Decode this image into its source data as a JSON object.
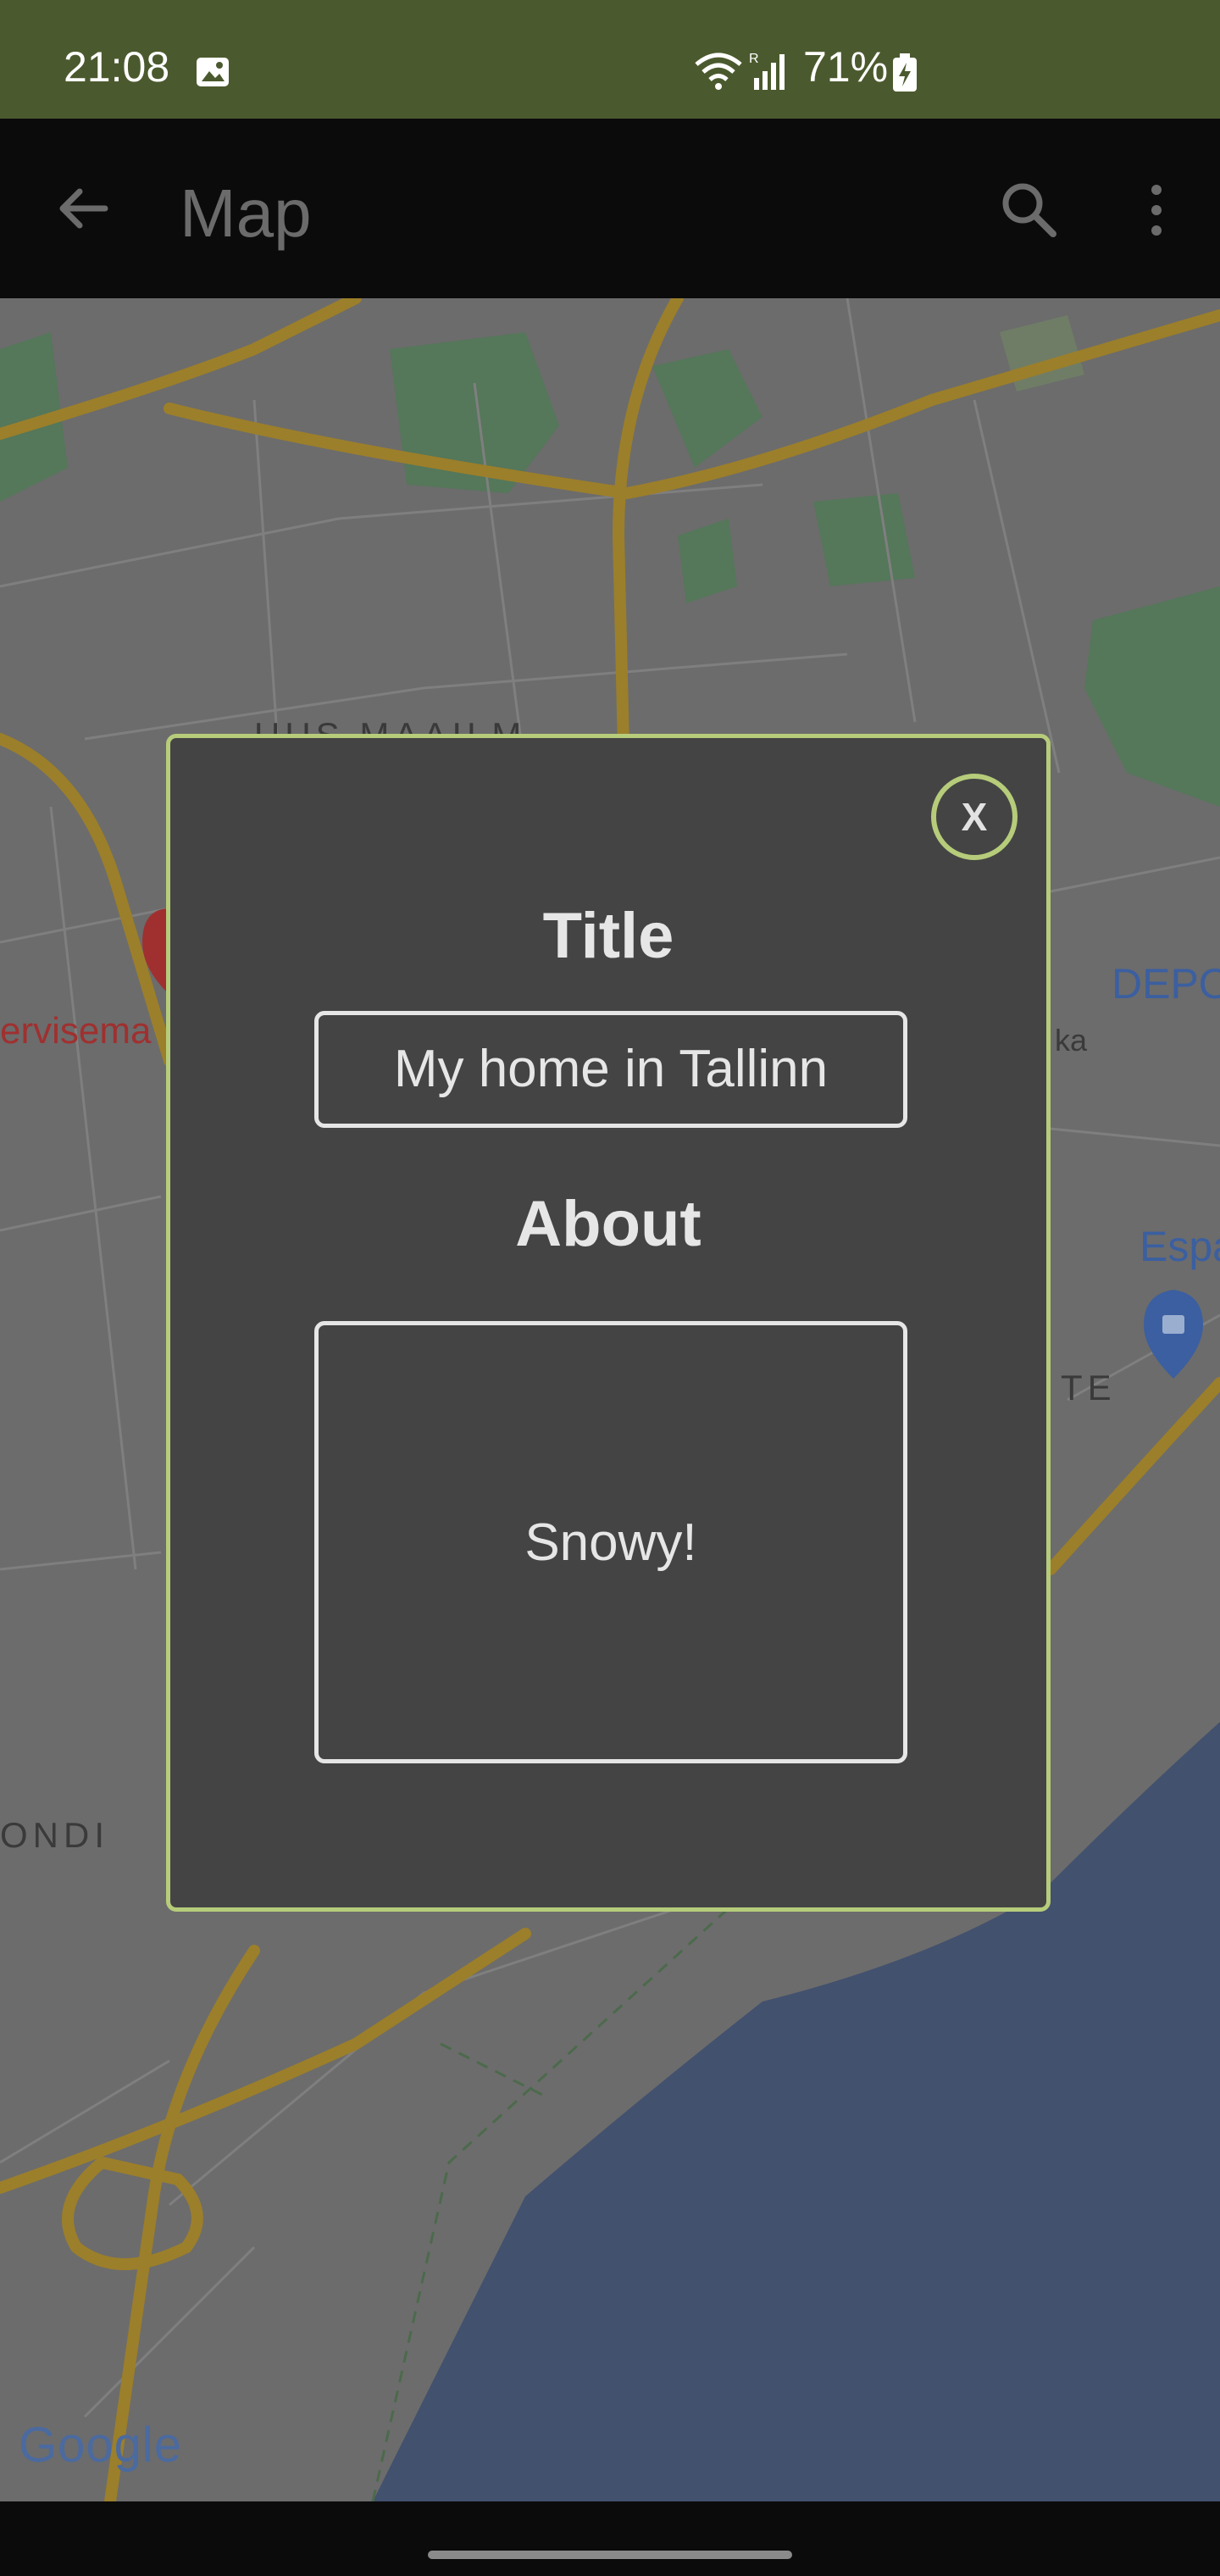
{
  "status_bar": {
    "time": "21:08",
    "battery": "71%"
  },
  "app_bar": {
    "title": "Map"
  },
  "map": {
    "labels": {
      "district_top": "UUS MAAILM",
      "district_left": "ONDI",
      "district_right": "TE",
      "place_left": "ervisema",
      "place_right": "DEPO",
      "place_right2": "Espa",
      "street": "ka"
    },
    "logo": "Google"
  },
  "dialog": {
    "close_label": "X",
    "title_label": "Title",
    "title_value": "My home in Tallinn",
    "about_label": "About",
    "about_value": "Snowy!"
  }
}
